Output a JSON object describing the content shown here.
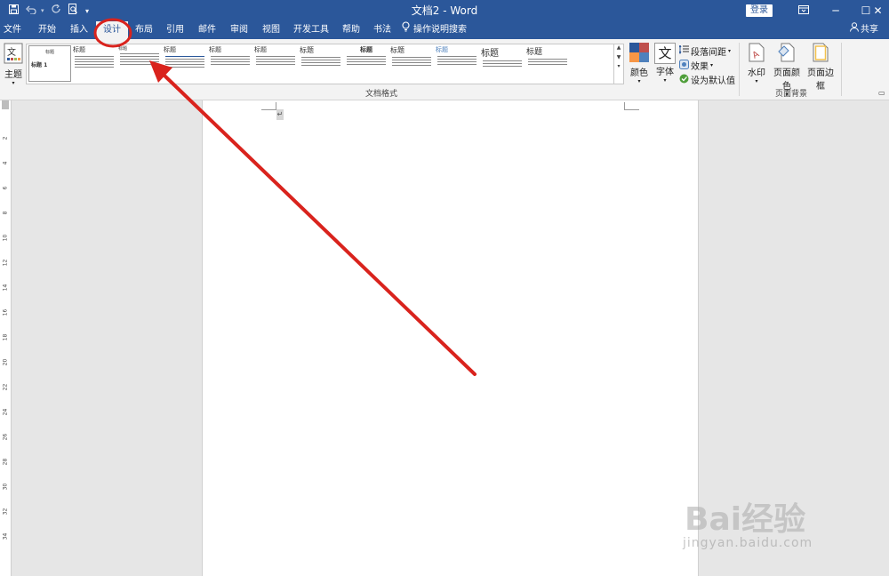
{
  "titlebar": {
    "title": "文档2 - Word",
    "login": "登录",
    "share": "共享",
    "bg_color": "#2b579a"
  },
  "qat": {
    "save": "save-icon",
    "undo": "undo-icon",
    "redo": "redo-icon",
    "print_preview": "print-preview-icon",
    "customize": "customize-qat-icon"
  },
  "tabs": [
    {
      "label": "文件",
      "active": false
    },
    {
      "label": "开始",
      "active": false
    },
    {
      "label": "插入",
      "active": false
    },
    {
      "label": "设计",
      "active": true
    },
    {
      "label": "布局",
      "active": false
    },
    {
      "label": "引用",
      "active": false
    },
    {
      "label": "邮件",
      "active": false
    },
    {
      "label": "审阅",
      "active": false
    },
    {
      "label": "视图",
      "active": false
    },
    {
      "label": "开发工具",
      "active": false
    },
    {
      "label": "帮助",
      "active": false
    },
    {
      "label": "书法",
      "active": false
    },
    {
      "label": "操作说明搜索",
      "active": false
    }
  ],
  "ribbon": {
    "theme_label": "主题",
    "gallery_first_title": "标题 1",
    "style_thumbs": [
      "标题",
      "标题",
      "标题",
      "标题",
      "标题",
      "标题",
      "标题",
      "标题",
      "标题",
      "标题",
      "标题",
      "标题"
    ],
    "colors_label": "颜色",
    "fonts_label": "字体",
    "font_glyph": "文",
    "paragraph_spacing": "段落间距",
    "effects": "效果",
    "set_default": "设为默认值",
    "group_doc_format": "文档格式",
    "watermark": "水印",
    "page_color": "页面颜色",
    "page_borders": "页面边框",
    "group_page_bg": "页面背景"
  },
  "ruler": {
    "numbers": [
      "2",
      "4",
      "6",
      "8",
      "10",
      "12",
      "14",
      "16",
      "18",
      "20",
      "22",
      "24",
      "26",
      "28",
      "30",
      "32",
      "34"
    ]
  },
  "annotation": {
    "color": "#d9231d",
    "note": "red circle on 设计 tab with arrow"
  },
  "watermark": {
    "brand": "Bai经验",
    "url": "jingyan.baidu.com"
  }
}
